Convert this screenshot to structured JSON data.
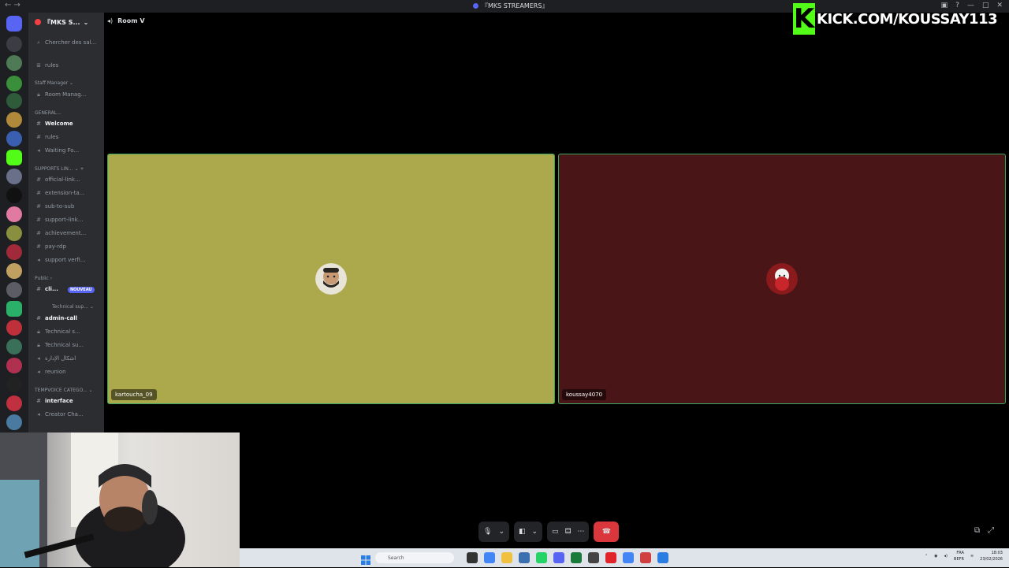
{
  "window": {
    "title": "『MKS STREAMERS』"
  },
  "overlay": {
    "kick_letter": "K",
    "kick_url": "KICK.COM/KOUSSAY113"
  },
  "server": {
    "name": "『MKS S..."
  },
  "channels": {
    "search": "Chercher des sal...",
    "rules_top": "rules",
    "cat_staff": "Staff Manager",
    "room_manager": "Room Manag...",
    "cat_general": "GENERAL...",
    "welcome": "Welcome",
    "rules": "rules",
    "waiting": "Waiting Fo...",
    "cat_supports": "SUPPORTS LIN...",
    "official": "official-link...",
    "extension": "extension-ta...",
    "subtosub": "sub-to-sub",
    "support_link": "support-link...",
    "achievement": "achievement...",
    "pay_rdp": "pay-rdp",
    "support_verif": "support verfi...",
    "cat_public": "Public",
    "cli": "cli...",
    "nouveau": "NOUVEAU",
    "cat_technical": "Technical sup...",
    "admin_call": "admin-call",
    "technical_s": "Technical s...",
    "technical_su": "Technical su...",
    "idara": "اشكال الإدارة",
    "reunion": "reunion",
    "cat_tempvoice": "TEMPVOICE CATEGO...",
    "interface": "interface",
    "creator": "Creator Cha..."
  },
  "call": {
    "room": "Room V"
  },
  "participants": [
    {
      "name": "kartoucha_09",
      "color": "#aca84c"
    },
    {
      "name": "koussay4070",
      "color": "#4a1516"
    }
  ],
  "taskbar": {
    "search": "Search",
    "lang1": "FRA",
    "lang2": "BEFR",
    "time": "18:03",
    "date": "23/02/2026"
  },
  "colors": {
    "accent_green": "#53fc18",
    "end_call": "#da373c",
    "speaking_border": "#3ba55d"
  },
  "icons": [
    "microphone-icon",
    "camera-icon",
    "screen-share-icon",
    "activity-icon",
    "more-icon",
    "hangup-icon",
    "popout-icon",
    "fullscreen-icon"
  ]
}
